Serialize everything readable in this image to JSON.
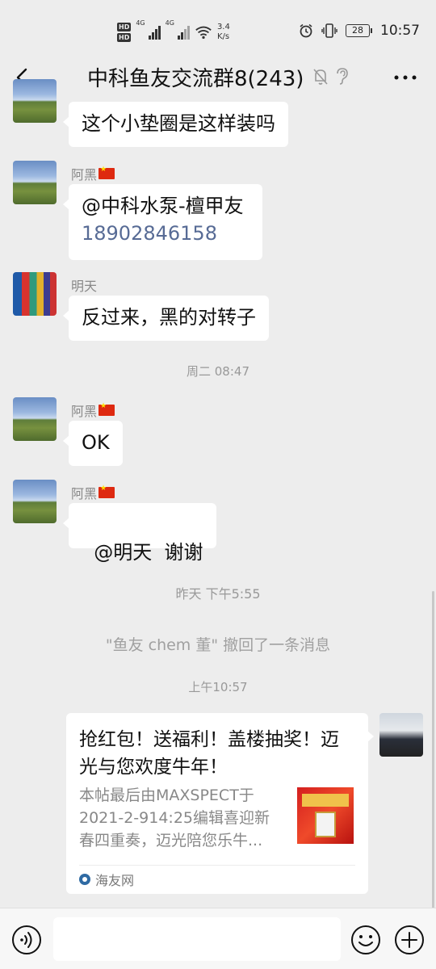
{
  "status_bar": {
    "hd1": "HD",
    "hd2": "HD",
    "net1": "4G",
    "net2": "4G",
    "speed_value": "3.4",
    "speed_unit": "K/s",
    "battery": "28",
    "time": "10:57"
  },
  "header": {
    "title": "中科鱼友交流群8(243)"
  },
  "messages": [
    {
      "text": "这个小垫圈是这样装吗"
    },
    {
      "sender": "阿黑",
      "text": "@中科水泵-檀甲友",
      "phone": "18902846158"
    },
    {
      "sender": "明天",
      "text": "反过来，黑的对转子"
    },
    {
      "time": "周二 08:47"
    },
    {
      "sender": "阿黑",
      "text": "OK"
    },
    {
      "sender": "阿黑",
      "text": "@明天  谢谢"
    },
    {
      "time": "昨天 下午5:55"
    },
    {
      "system": "\"鱼友 chem 董\" 撤回了一条消息"
    },
    {
      "time": "上午10:57"
    }
  ],
  "card": {
    "title": "抢红包！送福利！盖楼抽奖！迈光与您欢度牛年！",
    "desc": "本帖最后由MAXSPECT于2021-2-914:25编辑喜迎新春四重奏，迈光陪您乐牛...",
    "source": "海友网"
  },
  "colors": {
    "background": "#ededed",
    "bubble": "#ffffff",
    "link": "#576b95"
  },
  "icons": {
    "back": "chevron-left-icon",
    "mute": "bell-off-icon",
    "ear": "ear-icon",
    "more": "more-icon",
    "voice": "voice-icon",
    "emoji": "emoji-icon",
    "plus": "plus-icon"
  }
}
